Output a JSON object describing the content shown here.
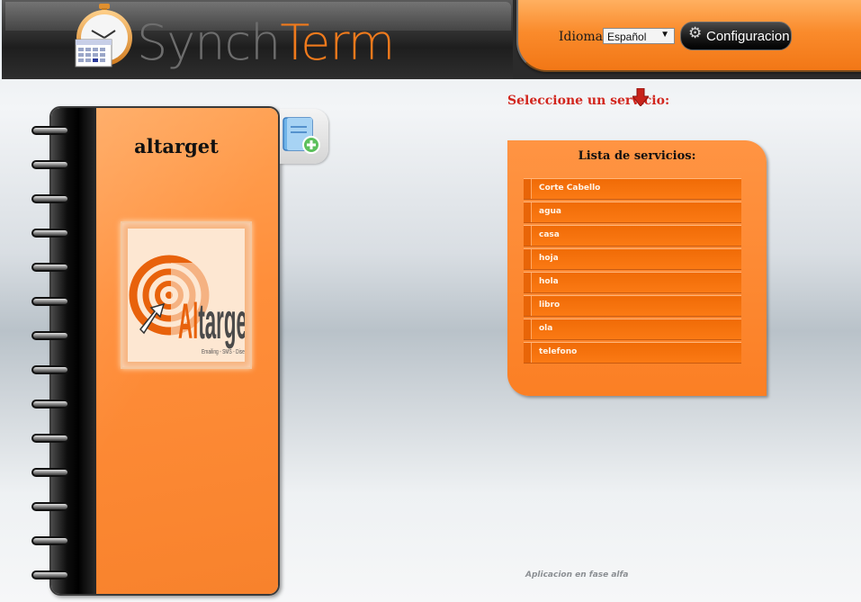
{
  "header": {
    "logo": {
      "text_synch": "Synch",
      "text_term": "Term"
    },
    "language_label": "Idioma:",
    "language_select_value": "Español",
    "config_button_label": "Configuracion"
  },
  "contact": {
    "name": "altarget",
    "logo_text": "Altarget",
    "logo_tagline": "Emailing - SMS - Diseño - New media"
  },
  "services": {
    "prompt": "Seleccione un servicio:",
    "title": "Lista de servicios:",
    "items": [
      "Corte Cabello",
      "agua",
      "casa",
      "hoja",
      "hola",
      "libro",
      "ola",
      "telefono"
    ]
  },
  "footer": {
    "note": "Aplicacion en fase alfa"
  },
  "colors": {
    "accent_orange": "#fb7f24",
    "prompt_red": "#d2261e",
    "header_dark": "#2b2b2b"
  },
  "icons": [
    "clock-calendar-icon",
    "gear-icon",
    "down-arrow-icon",
    "add-contact-icon"
  ]
}
